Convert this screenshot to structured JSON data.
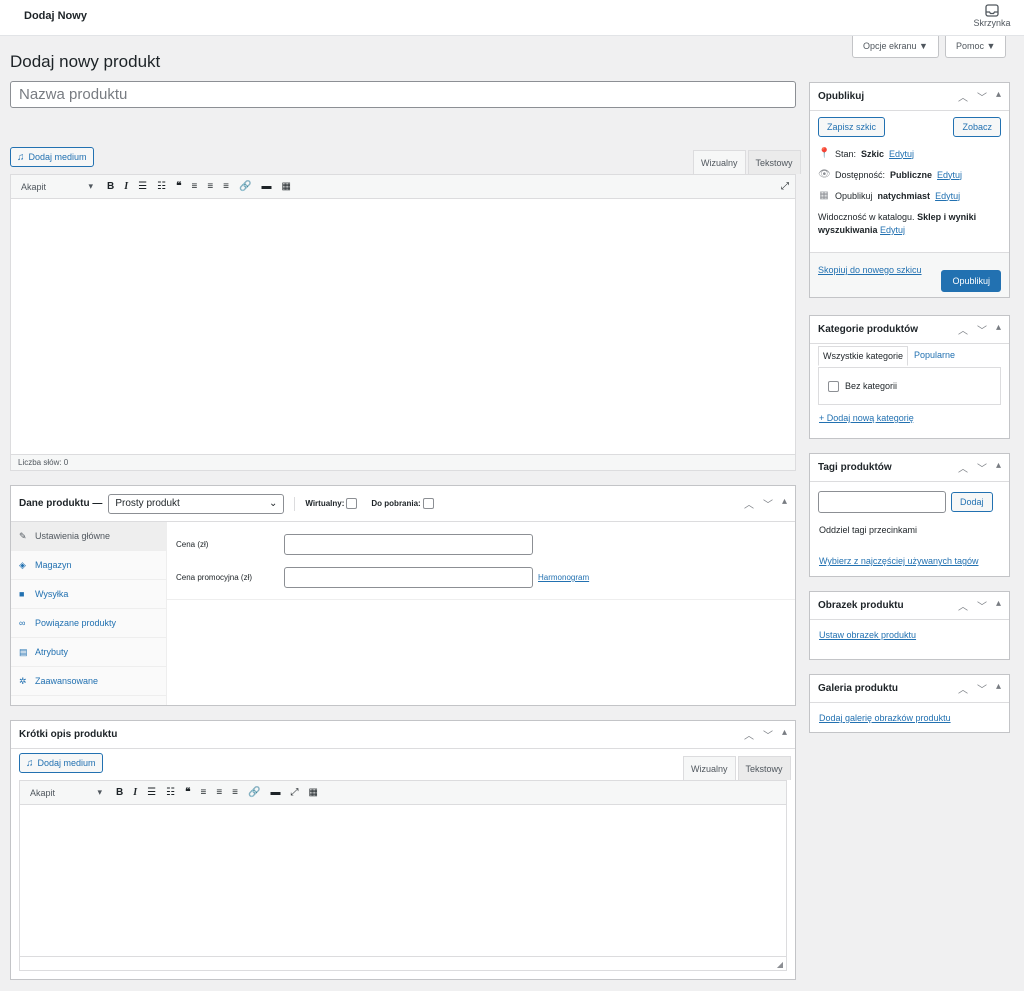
{
  "topbar": {
    "title": "Dodaj Nowy",
    "inbox_label": "Skrzynka"
  },
  "screen": {
    "options_label": "Opcje ekranu ▼",
    "help_label": "Pomoc ▼"
  },
  "page_title": "Dodaj nowy produkt",
  "product_name": {
    "placeholder": "Nazwa produktu",
    "value": ""
  },
  "editor": {
    "add_media": "Dodaj medium",
    "tab_visual": "Wizualny",
    "tab_text": "Tekstowy",
    "format": "Akapit",
    "word_count": "Liczba słów: 0"
  },
  "publish": {
    "title": "Opublikuj",
    "save_draft": "Zapisz szkic",
    "preview": "Zobacz",
    "status_label": "Stan:",
    "status_value": "Szkic",
    "visibility_label": "Dostępność:",
    "visibility_value": "Publiczne",
    "schedule_label": "Opublikuj",
    "schedule_value": "natychmiast",
    "edit": "Edytuj",
    "catalog_label": "Widoczność w katalogu.",
    "catalog_value": "Sklep i wyniki wyszukiwania",
    "copy_draft": "Skopiuj do nowego szkicu",
    "publish_btn": "Opublikuj"
  },
  "categories": {
    "title": "Kategorie produktów",
    "tab_all": "Wszystkie kategorie",
    "tab_popular": "Popularne",
    "items": [
      "Bez kategorii"
    ],
    "add_new": "+ Dodaj nową kategorię"
  },
  "tags": {
    "title": "Tagi produktów",
    "add_btn": "Dodaj",
    "hint": "Oddziel tagi przecinkami",
    "choose": "Wybierz z najczęściej używanych tagów"
  },
  "image": {
    "title": "Obrazek produktu",
    "link": "Ustaw obrazek produktu"
  },
  "gallery": {
    "title": "Galeria produktu",
    "link": "Dodaj galerię obrazków produktu"
  },
  "product_data": {
    "title": "Dane produktu —",
    "type": "Prosty produkt",
    "virtual": "Wirtualny:",
    "downloadable": "Do pobrania:",
    "tabs": [
      "Ustawienia główne",
      "Magazyn",
      "Wysyłka",
      "Powiązane produkty",
      "Atrybuty",
      "Zaawansowane"
    ],
    "price_label": "Cena (zł)",
    "sale_label": "Cena promocyjna (zł)",
    "schedule": "Harmonogram"
  },
  "short_desc": {
    "title": "Krótki opis produktu"
  },
  "colors": {
    "accent": "#2271b1",
    "bg": "#f0f0f1",
    "border": "#c3c4c7"
  }
}
